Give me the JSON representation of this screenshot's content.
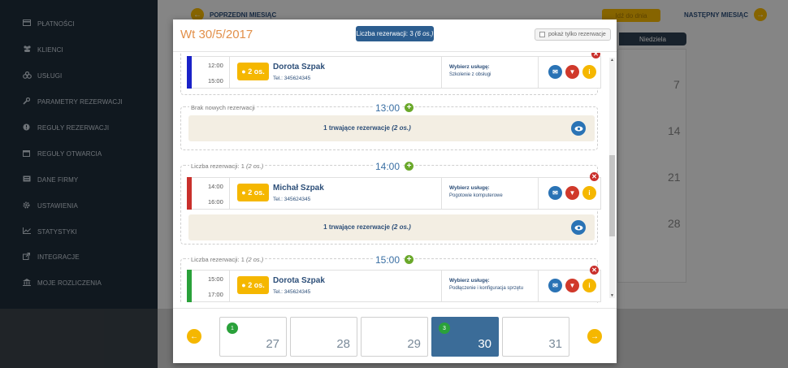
{
  "sidebar": {
    "items": [
      {
        "label": "Płatności",
        "icon": "credit-card-icon"
      },
      {
        "label": "Klienci",
        "icon": "users-icon"
      },
      {
        "label": "Usługi",
        "icon": "services-icon"
      },
      {
        "label": "Parametry rezerwacji",
        "icon": "wrench-icon"
      },
      {
        "label": "Reguły rezerwacji",
        "icon": "rules-icon"
      },
      {
        "label": "Reguły otwarcia",
        "icon": "calendar-icon"
      },
      {
        "label": "Dane firmy",
        "icon": "company-icon"
      },
      {
        "label": "Ustawienia",
        "icon": "gear-icon"
      },
      {
        "label": "Statystyki",
        "icon": "chart-icon"
      },
      {
        "label": "Integracje",
        "icon": "external-link-icon"
      },
      {
        "label": "Moje rozliczenia",
        "icon": "bank-icon"
      }
    ]
  },
  "background": {
    "prev_month": "POPRZEDNI MIESIĄC",
    "go_to_day": "Idź do dnia",
    "next_month": "NASTĘPNY MIESIĄC",
    "sunday": "Niedziela",
    "dates": [
      "7",
      "14",
      "21",
      "28"
    ]
  },
  "modal": {
    "title": "Wt 30/5/2017",
    "reservation_count_label": "Liczba rezerwacji: 3",
    "reservation_count_persons": "(6 os.)",
    "toggle_label": "pokaż tylko rezerwacje",
    "slots": [
      {
        "reservation": {
          "start": "12:00",
          "end": "15:00",
          "persons": "2 os.",
          "name": "Dorota Szpak",
          "tel": "Tel.: 345624345",
          "service_label": "Wybierz usługę:",
          "service": "Szkolenie z obsługi",
          "color": "#1a22c8"
        }
      },
      {
        "label": "Brak nowych rezerwacji",
        "time": "13:00",
        "ongoing_text": "1 trwające rezerwacje",
        "ongoing_persons": "(2 os.)"
      },
      {
        "label": "Liczba rezerwacji: 1",
        "label_persons": "(2 os.)",
        "time": "14:00",
        "reservation": {
          "start": "14:00",
          "end": "16:00",
          "persons": "2 os.",
          "name": "Michał Szpak",
          "tel": "Tel.: 345624345",
          "service_label": "Wybierz usługę:",
          "service": "Pogotowie komputerowe",
          "color": "#c9302c"
        },
        "ongoing_text": "1 trwające rezerwacje",
        "ongoing_persons": "(2 os.)"
      },
      {
        "label": "Liczba rezerwacji: 1",
        "label_persons": "(2 os.)",
        "time": "15:00",
        "reservation": {
          "start": "15:00",
          "end": "17:00",
          "persons": "2 os.",
          "name": "Dorota Szpak",
          "tel": "Tel.: 345624345",
          "service_label": "Wybierz usługę:",
          "service": "Podłączenie i konfiguracja sprzętu",
          "color": "#2aa13a"
        }
      }
    ],
    "days": [
      {
        "num": "27",
        "badge": "1"
      },
      {
        "num": "28",
        "badge": ""
      },
      {
        "num": "29",
        "badge": ""
      },
      {
        "num": "30",
        "badge": "3",
        "active": true
      },
      {
        "num": "31",
        "badge": ""
      }
    ]
  }
}
